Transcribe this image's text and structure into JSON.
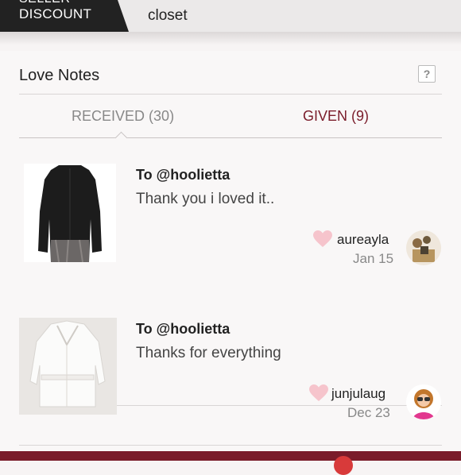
{
  "header": {
    "badge_line1": "SELLER",
    "badge_line2": "DISCOUNT",
    "closet_label": "closet"
  },
  "love_notes": {
    "title": "Love Notes",
    "help_label": "?",
    "tabs": {
      "received_label": "RECEIVED",
      "received_count": "(30)",
      "given_label": "GIVEN (9)"
    },
    "notes": [
      {
        "to": "To @hoolietta",
        "message": "Thank you i loved it..",
        "username": "aureayla",
        "date": "Jan 15"
      },
      {
        "to": "To @hoolietta",
        "message": "Thanks for everything",
        "username": "junjulaug",
        "date": "Dec 23"
      }
    ]
  },
  "colors": {
    "accent": "#7a1c2a",
    "heart": "#f6c4cc",
    "muted_text": "#888888"
  },
  "icons": {
    "help": "question-mark-icon",
    "like": "heart-icon"
  }
}
